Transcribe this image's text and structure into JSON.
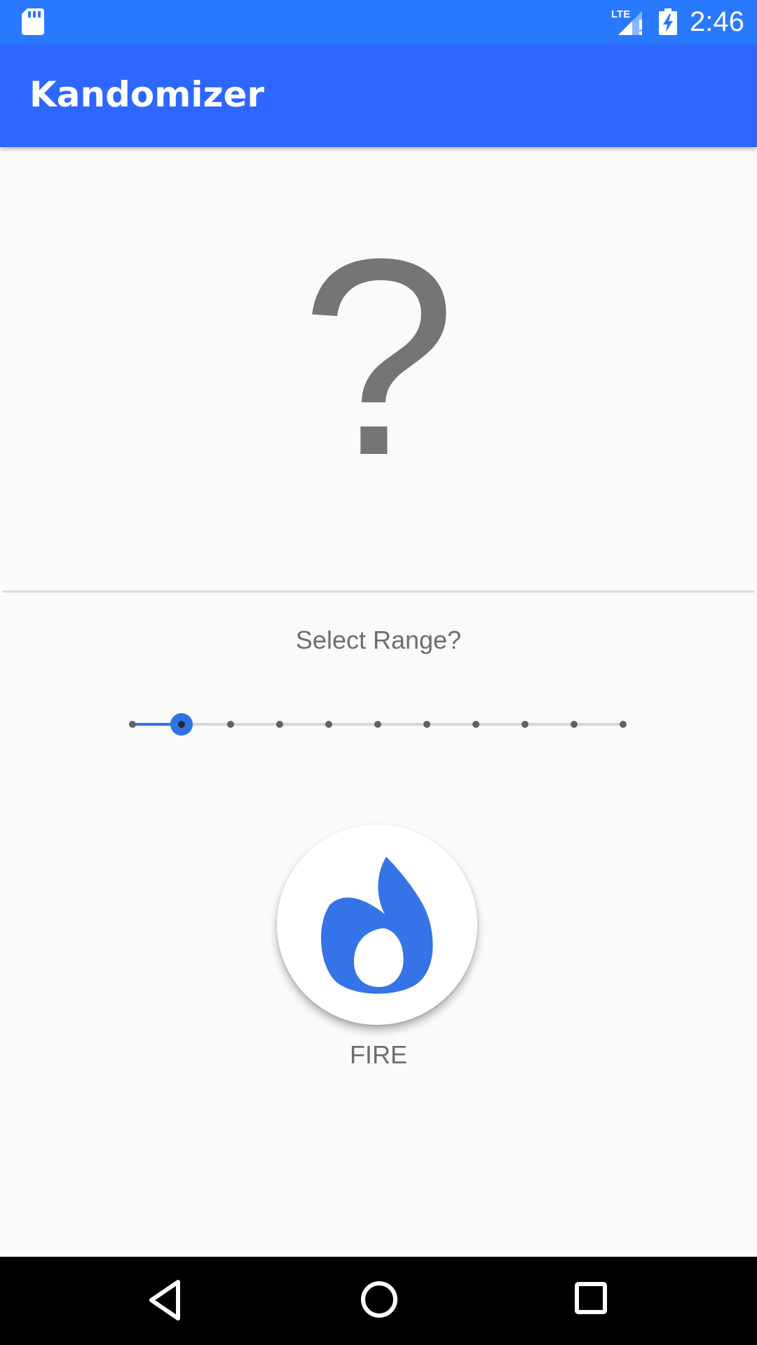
{
  "status_bar": {
    "time": "2:46",
    "icons": [
      "sd-card-icon",
      "lte-signal-icon",
      "battery-charging-icon"
    ],
    "color": "#2979ff"
  },
  "app_bar": {
    "title": "Kandomizer",
    "color": "#2d67ff"
  },
  "result": {
    "value": "?"
  },
  "range": {
    "label": "Select Range?",
    "steps": 11,
    "selected_index": 1,
    "accent_color": "#2f72e8"
  },
  "fire_button": {
    "icon": "flame-icon",
    "label": "FIRE",
    "icon_color": "#3574e8"
  },
  "nav_bar": {
    "icons": [
      "back-icon",
      "home-icon",
      "recents-icon"
    ]
  }
}
